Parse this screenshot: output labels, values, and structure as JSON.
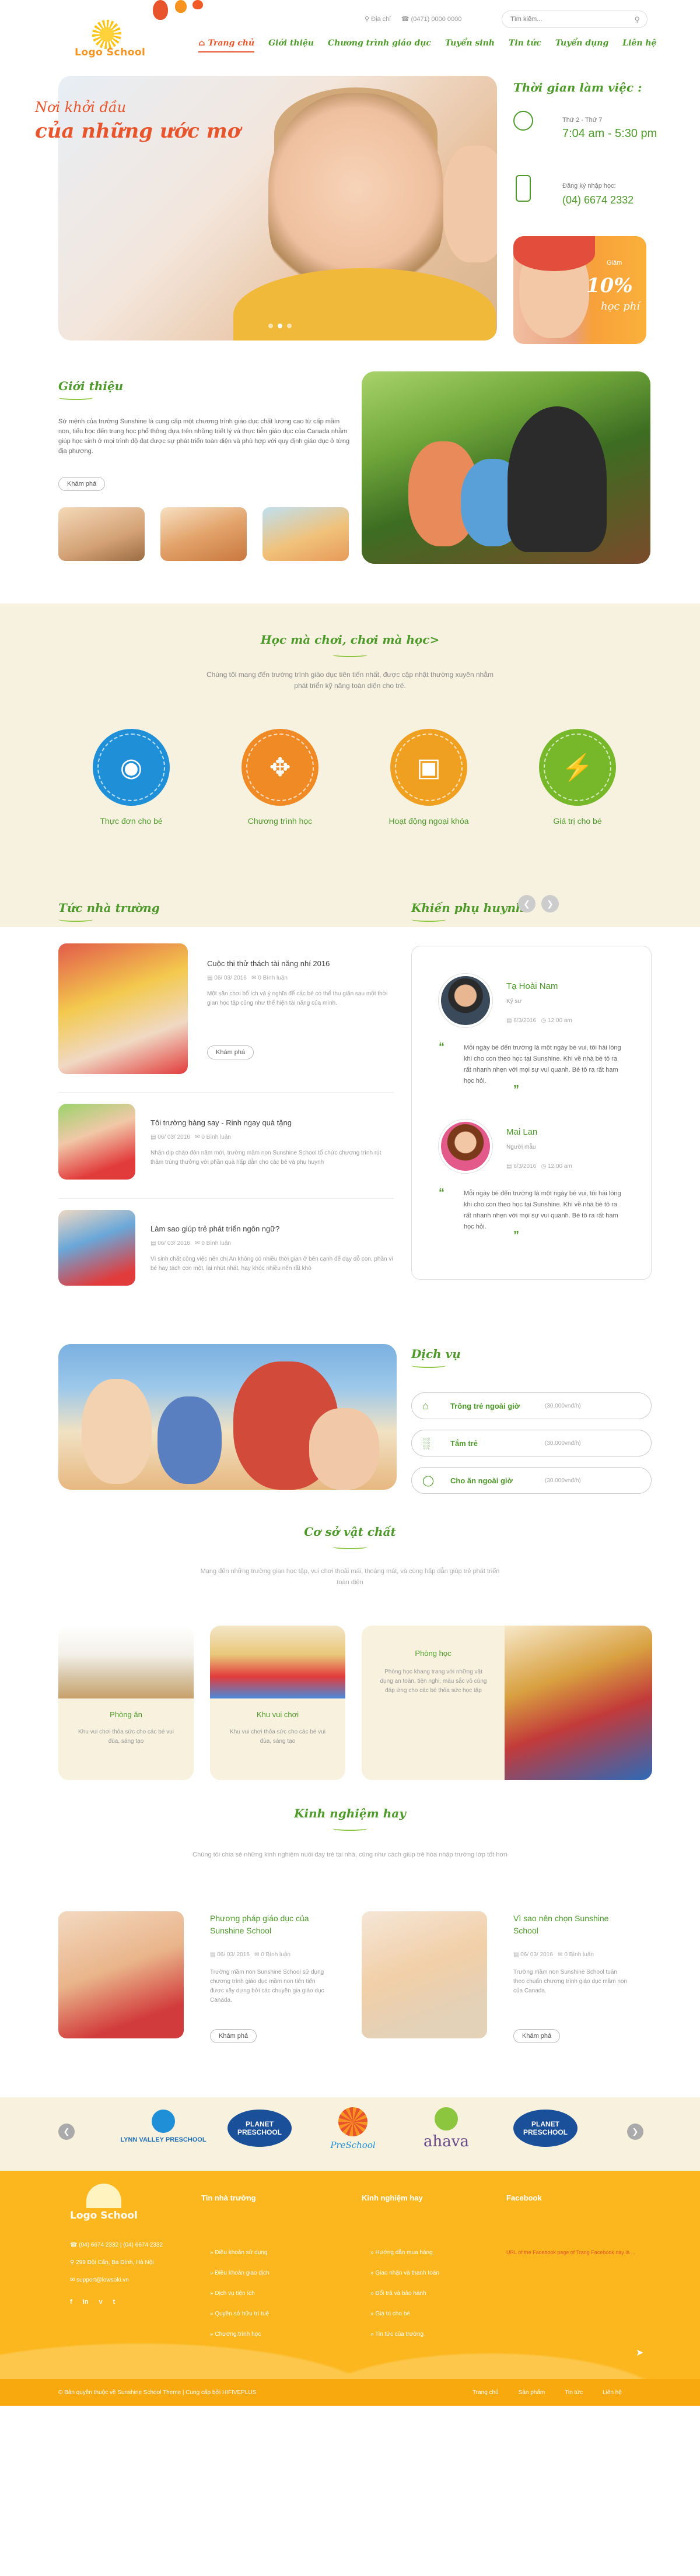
{
  "header": {
    "logo_text": "Logo School",
    "address": "Địa chỉ",
    "phone": "(0471) 0000 0000",
    "search_placeholder": "Tìm kiếm...",
    "nav": [
      "Trang chủ",
      "Giới thiệu",
      "Chương trình giáo dục",
      "Tuyển sinh",
      "Tin tức",
      "Tuyển dụng",
      "Liên hệ"
    ]
  },
  "hero": {
    "line1": "Nơi khởi đầu",
    "line2": "của những ước mơ"
  },
  "sidebar": {
    "hours_title": "Thời gian làm việc :",
    "hours_days": "Thứ 2 - Thứ 7",
    "hours_time": "7:04 am - 5:30 pm",
    "register_label": "Đăng ký nhập học:",
    "register_phone": "(04) 6674 2332",
    "promo_label": "Giảm",
    "promo_percent": "10%",
    "promo_text": "học phí"
  },
  "intro": {
    "title": "Giới thiệu",
    "text": "Sứ mệnh của trường Sunshine là cung cấp một chương trình giáo dục chất lượng cao từ cấp mầm non, tiểu học đến trung học phổ thông dựa trên những triết lý và thực tiễn giáo dục của Canada nhằm giúp học sinh ở mọi trình độ đạt được sự phát triển toàn diện và phù hợp với quy định giáo dục ở từng địa phương.",
    "button": "Khám phá"
  },
  "play": {
    "title": "Học mà chơi, chơi mà học>",
    "desc": "Chúng tôi mang đến trường trình giáo dục tiên tiến nhất, được cập nhật thường xuyên nhằm phát triển kỹ năng toàn diện cho trẻ.",
    "features": [
      "Thực đơn cho bé",
      "Chương trình học",
      "Hoạt động ngoại khóa",
      "Giá trị cho bé"
    ]
  },
  "news": {
    "title": "Tức nhà trường",
    "items": [
      {
        "title": "Cuộc thi thử thách tài năng nhí 2016",
        "date": "06/ 03/ 2016",
        "comments": "0 Bình luận",
        "excerpt": "Một sân chơi bổ ích và ý nghĩa để các bé có thể thu giãn sau một thời gian học tập cũng như thể hiện tài năng của mình.",
        "button": "Khám phá"
      },
      {
        "title": "Tôi trường hàng say - Rinh ngay quà tặng",
        "date": "06/ 03/ 2016",
        "comments": "0 Bình luận",
        "excerpt": "Nhân dịp chào đón năm mới, trường mầm non Sunshine School tổ chức chương trình rút thăm trúng thưởng với phần quà hấp dẫn cho các bé và phụ huynh"
      },
      {
        "title": "Làm sao giúp trẻ phát triển ngôn ngữ?",
        "date": "06/ 03/ 2016",
        "comments": "0 Bình luận",
        "excerpt": "Vì sinh chất công việc nên chị An không có nhiều thời gian ở bên cạnh để dạy dỗ con, phần vì bé hay tách con một, lại nhút nhát, hay khóc nhiều nên rất khó"
      }
    ]
  },
  "parents": {
    "title": "Khiến phụ huynh",
    "items": [
      {
        "name": "Tạ Hoài Nam",
        "role": "Kỹ sư",
        "date": "6/3/2016",
        "time": "12:00 am",
        "quote": "Mỗi ngày bé đến trường là một ngày bé vui, tôi hài lòng khi cho con theo học tại Sunshine. Khi về nhà bé tô ra rất nhanh nhẹn với mọi sự vui quanh. Bé tô ra rất ham học hỏi."
      },
      {
        "name": "Mai Lan",
        "role": "Người mẫu",
        "date": "6/3/2016",
        "time": "12:00 am",
        "quote": "Mỗi ngày bé đến trường là một ngày bé vui, tôi hài lòng khi cho con theo học tại Sunshine. Khi về nhà bé tô ra rất nhanh nhẹn với mọi sự vui quanh. Bé tô ra rất ham học hỏi."
      }
    ]
  },
  "services": {
    "title": "Dịch vụ",
    "items": [
      {
        "name": "Trông trẻ ngoài giờ",
        "age": "(30.000vnđ/h)"
      },
      {
        "name": "Tắm trẻ",
        "age": "(30.000vnđ/h)"
      },
      {
        "name": "Cho ăn ngoài giờ",
        "age": "(30.000vnđ/h)"
      }
    ]
  },
  "facilities": {
    "title": "Cơ sở vật chất",
    "desc": "Mang đến những trường gian học tập, vui chơi thoải mái, thoáng mát, và cùng hấp dẫn giúp trẻ phát triển toàn diện",
    "items": [
      {
        "title": "Phòng ăn",
        "desc": "Khu vui chơi thỏa sức cho các bé vui đùa, sáng tạo"
      },
      {
        "title": "Khu vui chơi",
        "desc": "Khu vui chơi thỏa sức cho các bé vui đùa, sáng tạo"
      },
      {
        "title": "Phòng học",
        "desc": "Phòng học khang trang với những vật dụng an toàn, tiện nghi, màu sắc vô cùng đáp ứng cho các bé thỏa sức học tập"
      }
    ]
  },
  "experience": {
    "title": "Kinh nghiệm hay",
    "desc": "Chúng tôi chia sẻ những kinh nghiệm nuôi dạy trẻ tại nhà, cũng như cách giúp trẻ hòa nhập trường lớp tốt hơn",
    "items": [
      {
        "title": "Phương pháp giáo dục của Sunshine School",
        "date": "06/ 03/ 2016",
        "comments": "0 Bình luận",
        "excerpt": "Trường mầm non Sunshine School sử dụng chương trình giáo dục mầm non tiên tiến được xây dựng bởi các chuyên gia giáo dục Canada.",
        "button": "Khám phá"
      },
      {
        "title": "Vì sao nên chọn Sunshine School",
        "date": "06/ 03/ 2016",
        "comments": "0 Bình luận",
        "excerpt": "Trường mầm non Sunshine School tuân theo chuẩn chương trình giáo dục mầm non của Canada.",
        "button": "Khám phá"
      }
    ]
  },
  "partners": [
    "LYNN VALLEY PRESCHOOL",
    "PLANET PRESCHOOL",
    "PreSchool",
    "ahava",
    "PLANET PRESCHOOL"
  ],
  "footer": {
    "logo_text": "Logo School",
    "phone": "(04) 6674 2332 | (04) 6674 2332",
    "address": "299 Đội Cấn, Ba Đình, Hà Nội",
    "email": "support@lowsoki.vn",
    "col1_title": "Tin nhà trường",
    "col1": [
      "Điều khoản sử dụng",
      "Điều khoản giao dịch",
      "Dịch vụ tiện ích",
      "Quyền sở hữu trí tuệ",
      "Chương trình học"
    ],
    "col2_title": "Kinh nghiệm hay",
    "col2": [
      "Hướng dẫn mua hàng",
      "Giao nhận và thanh toán",
      "Đổi trả và bảo hành",
      "Giá trị cho bé",
      "Tin tức của trường"
    ],
    "col3_title": "Facebook",
    "col3_note": "URL of the Facebook page of Trang Facebook này là ...",
    "copyright": "© Bản quyền thuộc về Sunshine School Theme | Cung cấp bởi HIFIVEPLUS",
    "menu": [
      "Trang chủ",
      "Sản phẩm",
      "Tin tức",
      "Liên hệ"
    ]
  },
  "colors": {
    "green": "#4d9a2a",
    "orange": "#e8542c",
    "yellow": "#fcb71e",
    "cream": "#f7f2df"
  }
}
